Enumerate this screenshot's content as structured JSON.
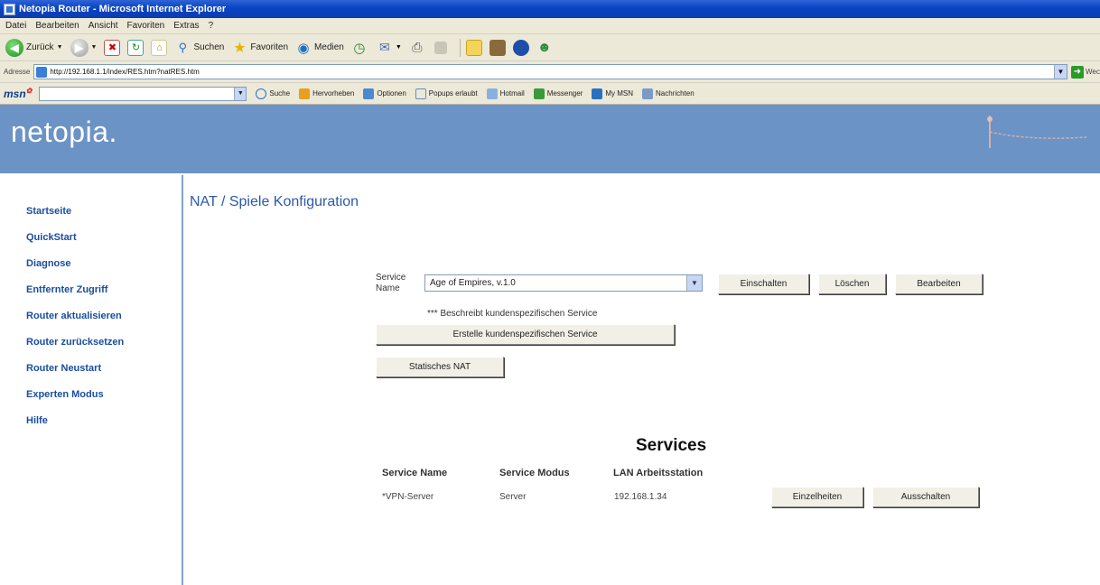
{
  "window": {
    "title": "Netopia Router - Microsoft Internet Explorer"
  },
  "menu": [
    "Datei",
    "Bearbeiten",
    "Ansicht",
    "Favoriten",
    "Extras",
    "?"
  ],
  "toolbar": {
    "back": "Zurück",
    "search": "Suchen",
    "favorites": "Favoriten",
    "media": "Medien"
  },
  "address": {
    "label": "Adresse",
    "url": "http://192.168.1.1/index/RES.htm?natRES.htm",
    "go_label": "Wechseln zu"
  },
  "msn": {
    "logo": "msn",
    "items": [
      "Suche",
      "Hervorheben",
      "Optionen",
      "Popups erlaubt",
      "Hotmail",
      "Messenger",
      "My MSN",
      "Nachrichten"
    ]
  },
  "brand": {
    "logo": "netopia."
  },
  "sidebar": {
    "items": [
      "Startseite",
      "QuickStart",
      "Diagnose",
      "Entfernter Zugriff",
      "Router aktualisieren",
      "Router zurücksetzen",
      "Router Neustart",
      "Experten Modus",
      "Hilfe"
    ]
  },
  "main": {
    "title": "NAT / Spiele Konfiguration",
    "service_label_1": "Service",
    "service_label_2": "Name",
    "service_selected": "Age of Empires, v.1.0",
    "btn_enable": "Einschalten",
    "btn_delete": "Löschen",
    "btn_edit": "Bearbeiten",
    "note": "*** Beschreibt kundenspezifischen Service",
    "btn_create_custom": "Erstelle kundenspezifischen Service",
    "btn_static_nat": "Statisches NAT"
  },
  "services": {
    "heading": "Services",
    "headers": [
      "Service Name",
      "Service Modus",
      "LAN Arbeitsstation"
    ],
    "rows": [
      {
        "name": "*VPN-Server",
        "mode": "Server",
        "host": "192.168.1.34",
        "btn_details": "Einzelheiten",
        "btn_disable": "Ausschalten"
      }
    ]
  }
}
